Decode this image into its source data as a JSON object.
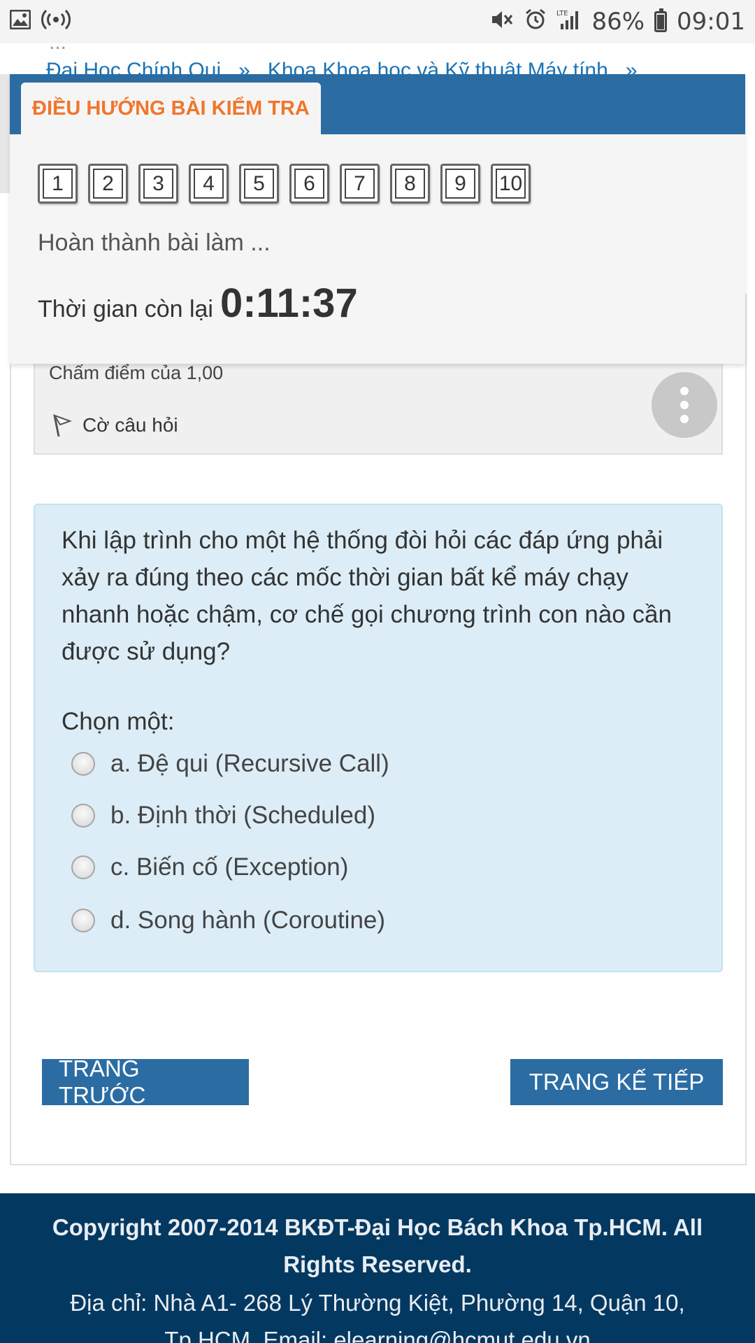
{
  "status_bar": {
    "battery": "86%",
    "time": "09:01",
    "network": "LTE",
    "icons": [
      "image-icon",
      "hotspot-icon",
      "mute-icon",
      "alarm-icon",
      "signal-icon",
      "battery-icon"
    ]
  },
  "breadcrumb": {
    "line1": "...",
    "items": [
      "Đại Học Chính Qui",
      "Khoa Khoa học và Kỹ thuật Máy tính"
    ],
    "separator": "»"
  },
  "quiz_nav": {
    "title": "ĐIỀU HƯỚNG BÀI KIỂM TRA",
    "question_numbers": [
      "1",
      "2",
      "3",
      "4",
      "5",
      "6",
      "7",
      "8",
      "9",
      "10"
    ],
    "finish_link": "Hoàn thành bài làm ...",
    "time_left_label": "Thời gian còn lại",
    "time_left_value": "0:11:37"
  },
  "question_info": {
    "grade": "Chấm điểm của 1,00",
    "flag_label": "Cờ câu hỏi"
  },
  "question": {
    "text": "Khi lập trình cho một hệ thống đòi hỏi các đáp ứng phải xảy ra đúng theo các mốc thời gian bất kể máy chạy nhanh hoặc chậm, cơ chế gọi chương trình con nào cần được sử dụng?",
    "prompt": "Chọn một:",
    "options": [
      "a. Đệ qui (Recursive Call)",
      "b. Định thời (Scheduled)",
      "c. Biến cố (Exception)",
      "d. Song hành (Coroutine)"
    ],
    "selected": null
  },
  "buttons": {
    "prev": "TRANG TRƯỚC",
    "next": "TRANG KẾ TIẾP"
  },
  "footer": {
    "copyright": "Copyright 2007-2014 BKĐT-Đại Học Bách Khoa Tp.HCM. All Rights Reserved.",
    "address": "Địa chỉ: Nhà A1- 268 Lý Thường Kiệt, Phường 14, Quận 10, Tp.HCM. Email: elearning@hcmut.edu.vn"
  },
  "colors": {
    "brand_blue": "#2b6ca3",
    "nav_title_orange": "#f0762b",
    "question_bg": "#dcedf7",
    "footer_bg": "#033860"
  }
}
